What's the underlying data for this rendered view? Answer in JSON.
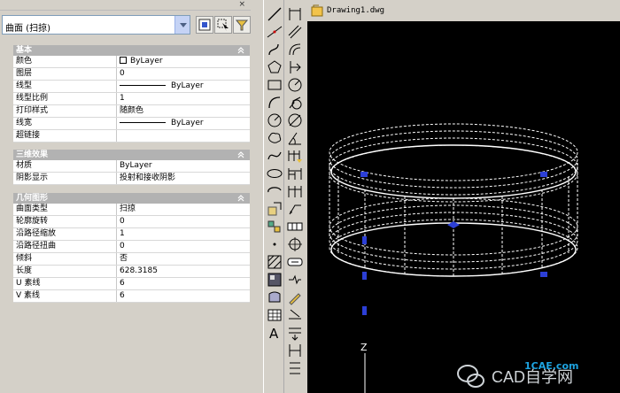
{
  "palette": {
    "close_glyph": "×",
    "selection": "曲面 (扫掠)"
  },
  "sections": [
    {
      "title": "基本",
      "rows": [
        {
          "key": "颜色",
          "value": "ByLayer",
          "swatch": true
        },
        {
          "key": "图层",
          "value": "0"
        },
        {
          "key": "线型",
          "value": "ByLayer",
          "line": true
        },
        {
          "key": "线型比例",
          "value": "1"
        },
        {
          "key": "打印样式",
          "value": "随颜色"
        },
        {
          "key": "线宽",
          "value": "ByLayer",
          "line": true
        },
        {
          "key": "超链接",
          "value": ""
        }
      ]
    },
    {
      "title": "三维效果",
      "rows": [
        {
          "key": "材质",
          "value": "ByLayer"
        },
        {
          "key": "阴影显示",
          "value": "投射和接收阴影"
        }
      ]
    },
    {
      "title": "几何图形",
      "rows": [
        {
          "key": "曲面类型",
          "value": "扫掠"
        },
        {
          "key": "轮廓旋转",
          "value": "0"
        },
        {
          "key": "沿路径缩放",
          "value": "1"
        },
        {
          "key": "沿路径扭曲",
          "value": "0"
        },
        {
          "key": "倾斜",
          "value": "否"
        },
        {
          "key": "长度",
          "value": "628.3185"
        },
        {
          "key": "U 素线",
          "value": "6"
        },
        {
          "key": "V 素线",
          "value": "6"
        }
      ]
    }
  ],
  "drawing": {
    "title": "Drawing1.dwg",
    "ucs_axis": "Z"
  },
  "watermark": {
    "text": "CAD自学网",
    "site": "1CAE.com"
  },
  "colors": {
    "category_bg": "#b2b2b2",
    "grip_blue": "#2c3fd6",
    "canvas": "#000000"
  }
}
